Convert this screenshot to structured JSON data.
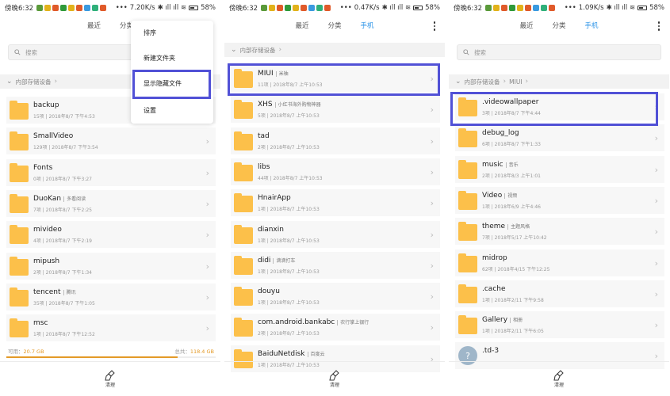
{
  "status_time": "傍晚6:32",
  "panels": [
    {
      "speed": "7.20K/s",
      "battery": "58%",
      "tabs": [
        "最近",
        "分类"
      ],
      "active_tab": -1,
      "search_placeholder": "搜索",
      "breadcrumb": [
        "内部存储设备"
      ],
      "menu": [
        "排序",
        "新建文件夹",
        "显示隐藏文件",
        "设置"
      ],
      "rows": [
        {
          "name": "backup",
          "tag": "",
          "meta": "15项 | 2018年8/7 下午4:53"
        },
        {
          "name": "SmallVideo",
          "tag": "",
          "meta": "129项 | 2018年8/7 下午3:54"
        },
        {
          "name": "Fonts",
          "tag": "",
          "meta": "0项 | 2018年8/7 下午3:27"
        },
        {
          "name": "DuoKan",
          "tag": "多看阅读",
          "meta": "7项 | 2018年8/7 下午2:25"
        },
        {
          "name": "mivideo",
          "tag": "",
          "meta": "4项 | 2018年8/7 下午2:19"
        },
        {
          "name": "mipush",
          "tag": "",
          "meta": "2项 | 2018年8/7 下午1:34"
        },
        {
          "name": "tencent",
          "tag": "腾讯",
          "meta": "35项 | 2018年8/7 下午1:05"
        },
        {
          "name": "msc",
          "tag": "",
          "meta": "1项 | 2018年8/7 下午12:52"
        }
      ],
      "storage": {
        "used_label": "可用：",
        "used": "20.7 GB",
        "total_label": "总共：",
        "total": "118.4 GB",
        "used_fraction": 0.82
      },
      "clean_label": "清理"
    },
    {
      "speed": "0.47K/s",
      "battery": "58%",
      "tabs": [
        "最近",
        "分类",
        "手机"
      ],
      "active_tab": 2,
      "breadcrumb": [
        "内部存储设备"
      ],
      "rows": [
        {
          "name": "MIUI",
          "tag": "米柚",
          "meta": "11项 | 2018年8/7 上午10:53"
        },
        {
          "name": "XHS",
          "tag": "小红书海外购物神器",
          "meta": "5项 | 2018年8/7 上午10:53"
        },
        {
          "name": "tad",
          "tag": "",
          "meta": "2项 | 2018年8/7 上午10:53"
        },
        {
          "name": "libs",
          "tag": "",
          "meta": "44项 | 2018年8/7 上午10:53"
        },
        {
          "name": "HnairApp",
          "tag": "",
          "meta": "1项 | 2018年8/7 上午10:53"
        },
        {
          "name": "dianxin",
          "tag": "",
          "meta": "1项 | 2018年8/7 上午10:53"
        },
        {
          "name": "didi",
          "tag": "滴滴打车",
          "meta": "1项 | 2018年8/7 上午10:53"
        },
        {
          "name": "douyu",
          "tag": "",
          "meta": "1项 | 2018年8/7 上午10:53"
        },
        {
          "name": "com.android.bankabc",
          "tag": "农行掌上银行",
          "meta": "2项 | 2018年8/7 上午10:53"
        },
        {
          "name": "BaiduNetdisk",
          "tag": "百度云",
          "meta": "1项 | 2018年8/7 上午10:53"
        }
      ],
      "clean_label": "清理"
    },
    {
      "speed": "1.09K/s",
      "battery": "58%",
      "tabs": [
        "最近",
        "分类",
        "手机"
      ],
      "active_tab": 2,
      "search_placeholder": "搜索",
      "breadcrumb": [
        "内部存储设备",
        "MIUI"
      ],
      "rows": [
        {
          "name": ".videowallpaper",
          "tag": "",
          "meta": "3项 | 2018年8/7 下午4:44"
        },
        {
          "name": "debug_log",
          "tag": "",
          "meta": "6项 | 2018年8/7 下午1:33"
        },
        {
          "name": "music",
          "tag": "音乐",
          "meta": "2项 | 2018年8/3 上午1:01"
        },
        {
          "name": "Video",
          "tag": "视频",
          "meta": "1项 | 2018年6/9 上午4:46"
        },
        {
          "name": "theme",
          "tag": "主题风格",
          "meta": "7项 | 2018年5/17 上午10:42"
        },
        {
          "name": "midrop",
          "tag": "",
          "meta": "62项 | 2018年4/15 下午12:25"
        },
        {
          "name": ".cache",
          "tag": "",
          "meta": "1项 | 2018年2/11 下午9:58"
        },
        {
          "name": "Gallery",
          "tag": "相册",
          "meta": "1项 | 2018年2/11 下午6:05"
        },
        {
          "name": ".td-3",
          "tag": "",
          "meta": "",
          "unknown": true
        }
      ],
      "clean_label": "清理"
    }
  ],
  "colors": {
    "accent": "#2c94e8",
    "folder": "#fcc04a",
    "highlight": "#5151d6",
    "storage": "#e39a28"
  },
  "icons": {
    "search": "search-icon",
    "folder": "folder-icon",
    "more": "more-vertical-icon",
    "chevron": "chevron-right-icon",
    "clean": "broom-icon"
  }
}
